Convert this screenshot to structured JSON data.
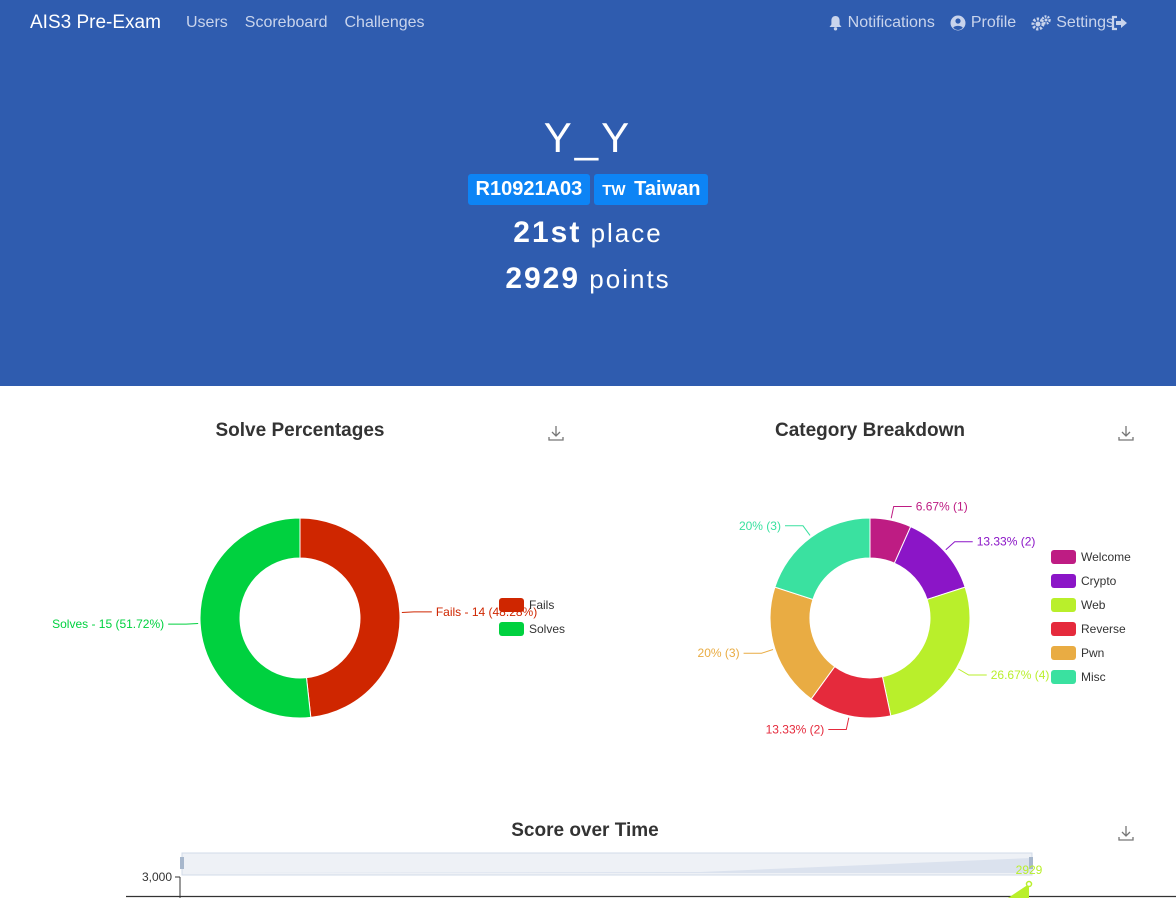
{
  "nav": {
    "brand": "AIS3 Pre-Exam",
    "links": [
      "Users",
      "Scoreboard",
      "Challenges"
    ],
    "notifications": "Notifications",
    "profile": "Profile",
    "settings": "Settings"
  },
  "team": {
    "name": "Y_Y",
    "affiliation": "R10921A03",
    "country_code": "TW",
    "country": "Taiwan",
    "place_num": "21st",
    "place_word": "place",
    "points_num": "2929",
    "points_word": "points"
  },
  "colors": {
    "navbar": "#2f5caf",
    "badge": "#0d84f5",
    "fails": "#cf2600",
    "solves": "#00d13f",
    "welcome": "#be1c83",
    "crypto": "#8b15c7",
    "web": "#b9ef2b",
    "reverse": "#e52a3c",
    "pwn": "#e9ac43",
    "misc": "#3ae1a0"
  },
  "chart_data": [
    {
      "type": "pie",
      "title": "Solve Percentages",
      "categories": [
        "Fails",
        "Solves"
      ],
      "values": [
        14,
        15
      ],
      "labels": [
        "Fails - 14 (48.28%)",
        "Solves - 15 (51.72%)"
      ],
      "legend": "right",
      "donut": true
    },
    {
      "type": "pie",
      "title": "Category Breakdown",
      "categories": [
        "Welcome",
        "Crypto",
        "Web",
        "Reverse",
        "Pwn",
        "Misc"
      ],
      "values": [
        1,
        2,
        4,
        2,
        3,
        3
      ],
      "labels": [
        "6.67% (1)",
        "13.33% (2)",
        "26.67% (4)",
        "13.33% (2)",
        "20% (3)",
        "20% (3)"
      ],
      "legend": "right",
      "donut": true
    },
    {
      "type": "line",
      "title": "Score over Time",
      "y_tick_top": "3,000",
      "last_value_label": "2929"
    }
  ]
}
